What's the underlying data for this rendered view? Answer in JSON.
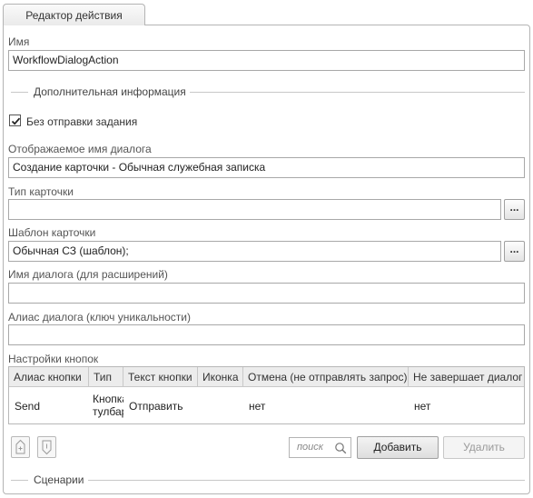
{
  "tab": {
    "label": "Редактор действия"
  },
  "name": {
    "label": "Имя",
    "value": "WorkflowDialogAction"
  },
  "section_additional": {
    "title": "Дополнительная информация"
  },
  "no_task": {
    "label": "Без отправки задания",
    "checked": true
  },
  "dialog_display_name": {
    "label": "Отображаемое имя диалога",
    "value": "Создание карточки - Обычная служебная записка"
  },
  "card_type": {
    "label": "Тип карточки",
    "value": "",
    "browse_label": "..."
  },
  "card_template": {
    "label": "Шаблон карточки",
    "value": "Обычная СЗ (шаблон);",
    "browse_label": "..."
  },
  "dialog_name_ext": {
    "label": "Имя диалога (для расширений)",
    "value": ""
  },
  "dialog_alias": {
    "label": "Алиас диалога (ключ уникальности)",
    "value": ""
  },
  "buttons_settings": {
    "label": "Настройки кнопок",
    "columns": [
      "Алиас кнопки",
      "Тип",
      "Текст кнопки",
      "Иконка",
      "Отмена (не отправлять запрос)",
      "Не завершает диалог"
    ],
    "rows": [
      {
        "alias": "Send",
        "type_line1": "Кнопка",
        "type_line2": "тулбара",
        "text": "Отправить",
        "icon": "",
        "cancel": "нет",
        "not_finish": "нет"
      }
    ]
  },
  "toolbar": {
    "search_placeholder": "поиск",
    "add_label": "Добавить",
    "delete_label": "Удалить",
    "move_up_icon": "arrow-up-icon",
    "move_down_icon": "arrow-down-icon"
  },
  "section_scenarios": {
    "title": "Сценарии"
  }
}
